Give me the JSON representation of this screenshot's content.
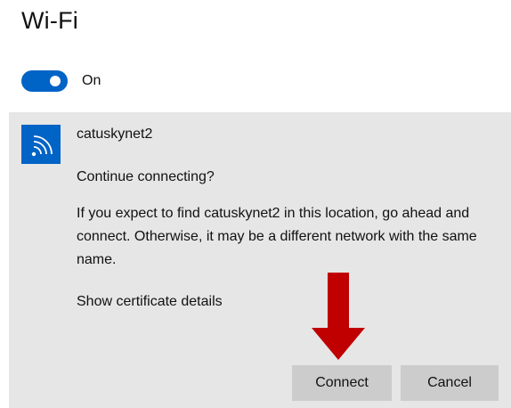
{
  "header": {
    "title": "Wi-Fi"
  },
  "wifi_toggle": {
    "state": true,
    "label": "On"
  },
  "network": {
    "icon": "wifi-signal-icon",
    "name": "catuskynet2",
    "question": "Continue connecting?",
    "message": "If you expect to find catuskynet2 in this location, go ahead and connect. Otherwise, it may be a different network with the same name.",
    "certificate_link": "Show certificate details"
  },
  "buttons": {
    "connect_label": "Connect",
    "cancel_label": "Cancel"
  },
  "annotation": {
    "icon": "down-arrow-icon",
    "color": "#c00000"
  },
  "colors": {
    "accent": "#0063c6",
    "panel": "#e6e6e6",
    "button": "#cccccc"
  }
}
